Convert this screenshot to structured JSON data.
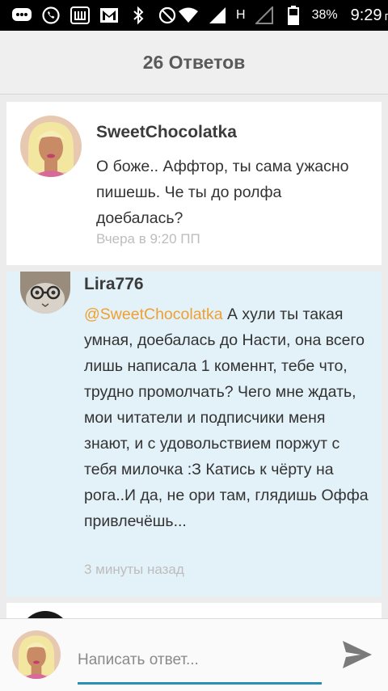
{
  "status_bar": {
    "network_type": "H",
    "battery": "38%",
    "time": "9:29",
    "time_suffix": "пп",
    "icons": [
      "messages-icon",
      "whatsapp-icon",
      "vk-icon",
      "gmail-icon",
      "bluetooth-icon",
      "do-not-disturb-icon",
      "wifi-icon",
      "signal-icon",
      "signal-empty-icon",
      "battery-icon"
    ]
  },
  "header": {
    "title": "26 Ответов"
  },
  "comments": [
    {
      "author": "SweetChocolatka",
      "text": "О боже.. Аффтор, ты сама ужасно пишешь. Че ты до ролфа доебалась?",
      "time": "Вчера в 9:20 ПП",
      "highlighted": false
    },
    {
      "author": "Lira776",
      "mention": "@SweetChocolatka",
      "text": " А хули ты такая умная, доебалась до Насти, она всего лишь написала 1 коменнт, тебе что, трудно промолчать? Чего мне ждать, мои читатели и подписчики меня знают, и с удовольствием поржут с тебя милочка :З Катись к чёрту на рога..И да, не ори там, глядишь Оффа привлечёшь...",
      "time": "3 минуты назад",
      "highlighted": true
    }
  ],
  "composer": {
    "placeholder": "Написать ответ..."
  },
  "colors": {
    "accent": "#2a8fb5",
    "mention": "#f0a030",
    "highlight_bg": "#e3f1f8"
  }
}
